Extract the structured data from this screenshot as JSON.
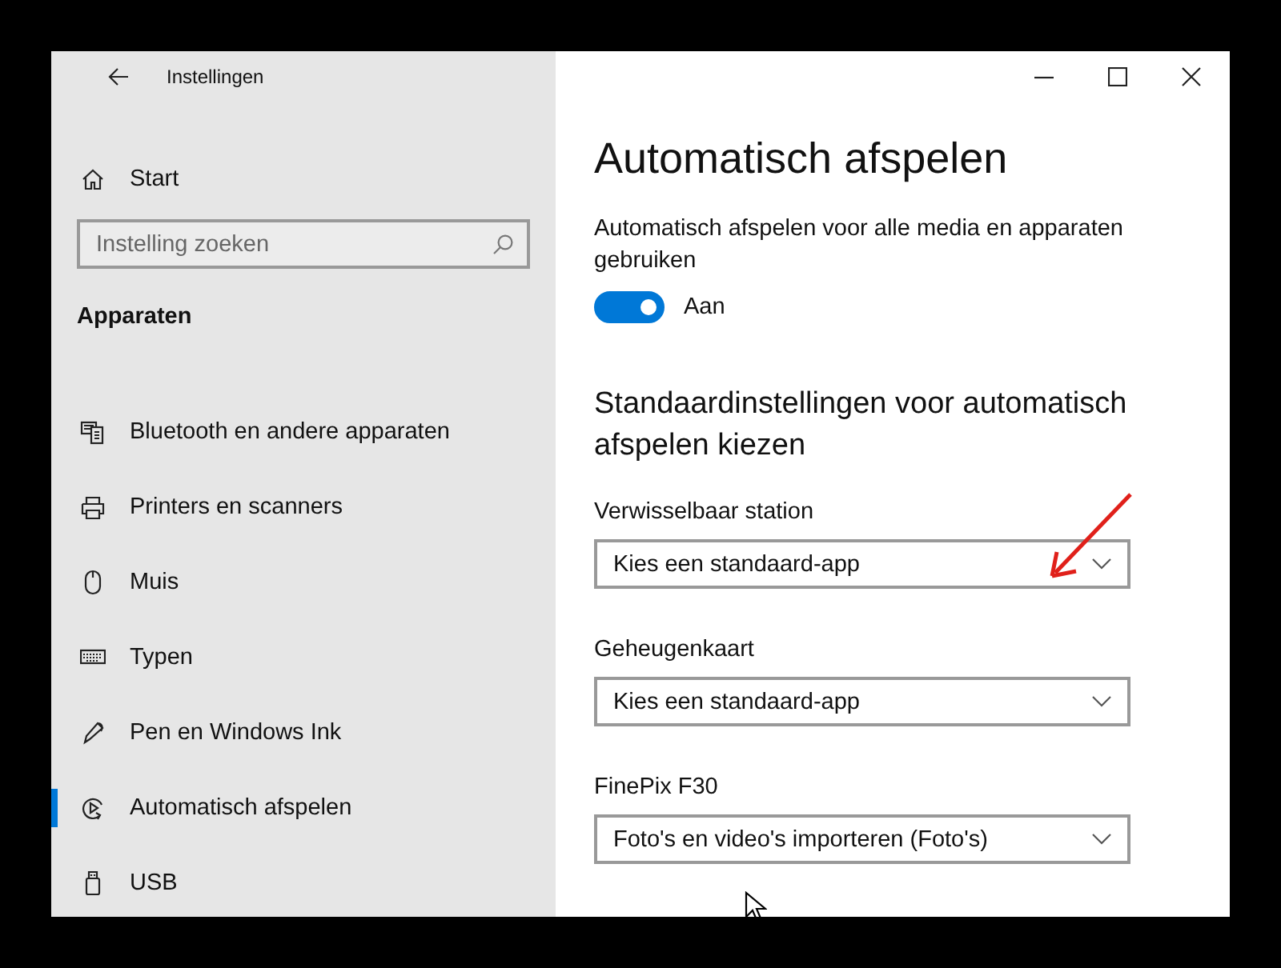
{
  "window": {
    "title": "Instellingen"
  },
  "sidebar": {
    "home": "Start",
    "search": {
      "placeholder": "Instelling zoeken"
    },
    "section": "Apparaten",
    "items": [
      {
        "label": "Bluetooth en andere apparaten",
        "selected": false
      },
      {
        "label": "Printers en scanners",
        "selected": false
      },
      {
        "label": "Muis",
        "selected": false
      },
      {
        "label": "Typen",
        "selected": false
      },
      {
        "label": "Pen en Windows Ink",
        "selected": false
      },
      {
        "label": "Automatisch afspelen",
        "selected": true
      },
      {
        "label": "USB",
        "selected": false
      }
    ]
  },
  "content": {
    "title": "Automatisch afspelen",
    "autoplay": {
      "label": "Automatisch afspelen voor alle media en apparaten gebruiken",
      "on": true,
      "state_text": "Aan"
    },
    "section_title": "Standaardinstellingen voor automatisch afspelen kiezen",
    "defaults": [
      {
        "label": "Verwisselbaar station",
        "value": "Kies een standaard-app"
      },
      {
        "label": "Geheugenkaart",
        "value": "Kies een standaard-app"
      },
      {
        "label": "FinePix F30",
        "value": "Foto's en video's importeren (Foto's)"
      }
    ]
  }
}
